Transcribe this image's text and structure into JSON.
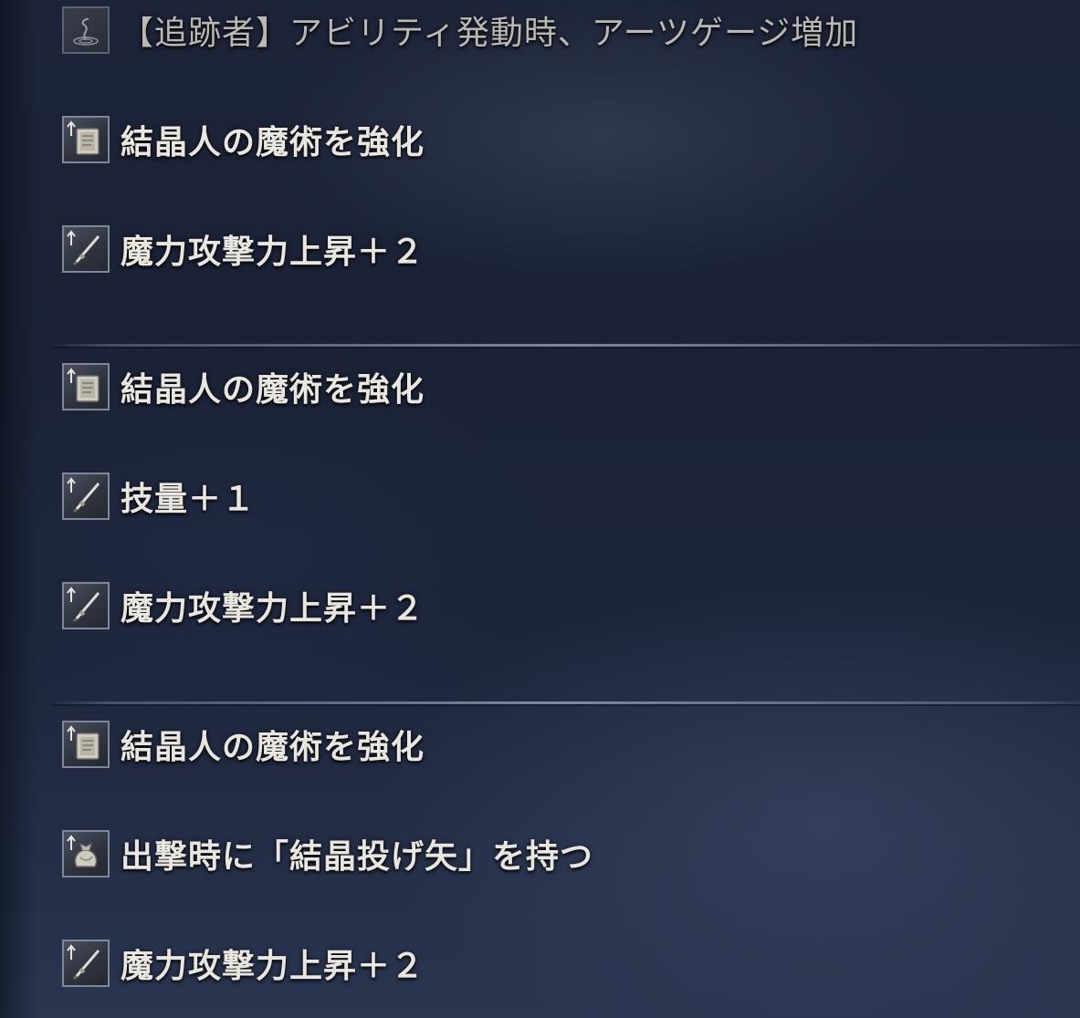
{
  "effects": {
    "top": {
      "icon": "ripple-icon",
      "label": "【追跡者】アビリティ発動時、アーツゲージ増加"
    },
    "group1": [
      {
        "icon": "tome-up-icon",
        "label": "結晶人の魔術を強化"
      },
      {
        "icon": "sword-up-icon",
        "label": "魔力攻撃力上昇＋２"
      }
    ],
    "group2": [
      {
        "icon": "tome-up-icon",
        "label": "結晶人の魔術を強化"
      },
      {
        "icon": "sword-up-icon",
        "label": "技量＋１"
      },
      {
        "icon": "sword-up-icon",
        "label": "魔力攻撃力上昇＋２"
      }
    ],
    "group3": [
      {
        "icon": "tome-up-icon",
        "label": "結晶人の魔術を強化"
      },
      {
        "icon": "pouch-icon",
        "label": "出撃時に「結晶投げ矢」を持つ"
      },
      {
        "icon": "sword-up-icon",
        "label": "魔力攻撃力上昇＋２"
      }
    ]
  }
}
